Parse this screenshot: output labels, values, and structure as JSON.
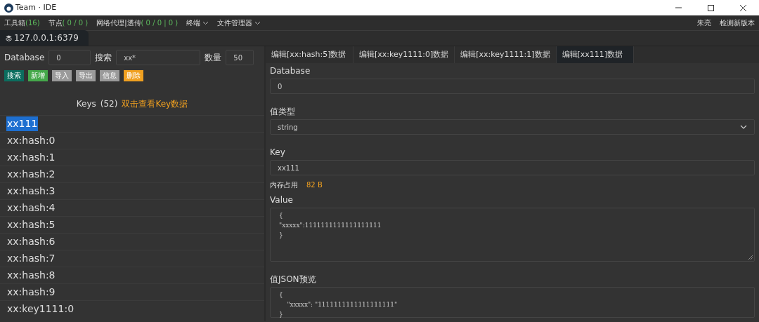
{
  "window": {
    "title": "Team · IDE"
  },
  "menu": [
    {
      "label": "工具箱",
      "count": "(16)",
      "dropdown": false
    },
    {
      "label": "节点",
      "count": "( 0 / 0 )",
      "dropdown": false
    },
    {
      "label": "网络代理|透传",
      "count": "( 0 / 0 | 0 )",
      "dropdown": false
    },
    {
      "label": "终端",
      "dropdown": true
    },
    {
      "label": "文件管理器",
      "dropdown": true
    }
  ],
  "menu_right": [
    "朱亮",
    "检测新版本"
  ],
  "connection_tabs": [
    {
      "label": "127.0.0.1:6379",
      "selected": true
    }
  ],
  "search_bar": {
    "database_label": "Database",
    "database_value": "0",
    "search_label": "搜索",
    "search_value": "xx*",
    "count_label": "数量",
    "count_value": "50"
  },
  "actions": [
    {
      "label": "搜索",
      "kind": "search"
    },
    {
      "label": "新增",
      "kind": "add"
    },
    {
      "label": "导入",
      "kind": "plain"
    },
    {
      "label": "导出",
      "kind": "plain"
    },
    {
      "label": "信息",
      "kind": "plain"
    },
    {
      "label": "删除",
      "kind": "danger"
    }
  ],
  "keys_header": {
    "title": "Keys",
    "count": "(52)",
    "hint": "双击查看Key数据"
  },
  "keys": [
    {
      "name": "xx111",
      "selected": true
    },
    {
      "name": "xx:hash:0",
      "selected": false
    },
    {
      "name": "xx:hash:1",
      "selected": false
    },
    {
      "name": "xx:hash:2",
      "selected": false
    },
    {
      "name": "xx:hash:3",
      "selected": false
    },
    {
      "name": "xx:hash:4",
      "selected": false
    },
    {
      "name": "xx:hash:5",
      "selected": false
    },
    {
      "name": "xx:hash:6",
      "selected": false
    },
    {
      "name": "xx:hash:7",
      "selected": false
    },
    {
      "name": "xx:hash:8",
      "selected": false
    },
    {
      "name": "xx:hash:9",
      "selected": false
    },
    {
      "name": "xx:key1111:0",
      "selected": false
    }
  ],
  "editor_tabs": [
    {
      "label": "编辑[xx:hash:5]数据",
      "selected": false
    },
    {
      "label": "编辑[xx:key1111:0]数据",
      "selected": false
    },
    {
      "label": "编辑[xx:key1111:1]数据",
      "selected": false
    },
    {
      "label": "编辑[xx111]数据",
      "selected": true
    }
  ],
  "editor": {
    "database_label": "Database",
    "database_value": "0",
    "type_label": "值类型",
    "type_value": "string",
    "key_label": "Key",
    "key_value": "xx111",
    "memory_label": "内存占用",
    "memory_value": "82  B",
    "value_label": "Value",
    "value_lines": [
      "{",
      "\"xxxxx\":1111111111111111111",
      "}"
    ],
    "preview_label": "值JSON预览",
    "preview_lines": [
      "{",
      "    \"xxxxx\": \"1111111111111111111\"",
      "}"
    ]
  }
}
